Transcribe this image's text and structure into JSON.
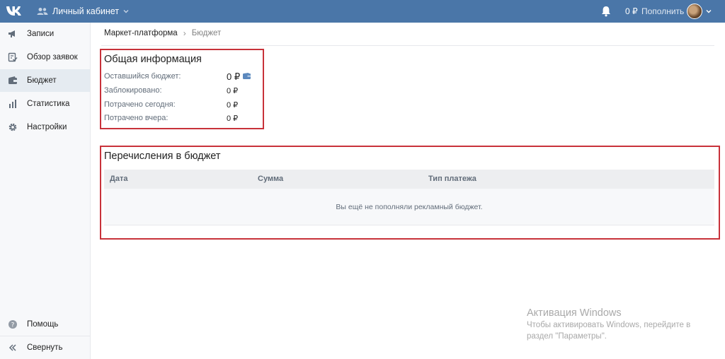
{
  "topbar": {
    "cabinet_label": "Личный кабинет",
    "balance": "0 ₽",
    "topup_label": "Пополнить",
    "bg_color": "#4a76a8"
  },
  "sidebar": {
    "items": [
      {
        "label": "Записи",
        "icon": "megaphone-icon"
      },
      {
        "label": "Обзор заявок",
        "icon": "checklist-icon"
      },
      {
        "label": "Бюджет",
        "icon": "wallet-icon",
        "active": true
      },
      {
        "label": "Статистика",
        "icon": "bar-chart-icon"
      },
      {
        "label": "Настройки",
        "icon": "gear-icon"
      }
    ],
    "help_label": "Помощь",
    "collapse_label": "Свернуть"
  },
  "breadcrumb": {
    "parent": "Маркет-платформа",
    "current": "Бюджет"
  },
  "general": {
    "title": "Общая информация",
    "rows": [
      {
        "label": "Оставшийся бюджет:",
        "value": "0 ₽"
      },
      {
        "label": "Заблокировано:",
        "value": "0 ₽"
      },
      {
        "label": "Потрачено сегодня:",
        "value": "0 ₽"
      },
      {
        "label": "Потрачено вчера:",
        "value": "0 ₽"
      }
    ]
  },
  "transfers": {
    "title": "Перечисления в бюджет",
    "columns": [
      "Дата",
      "Сумма",
      "Тип платежа"
    ],
    "empty_text": "Вы ещё не пополняли рекламный бюджет."
  },
  "watermark": {
    "title": "Активация Windows",
    "text": "Чтобы активировать Windows, перейдите в раздел \"Параметры\"."
  },
  "colors": {
    "accent": "#4a76a8",
    "highlight_border": "#c8323a"
  }
}
